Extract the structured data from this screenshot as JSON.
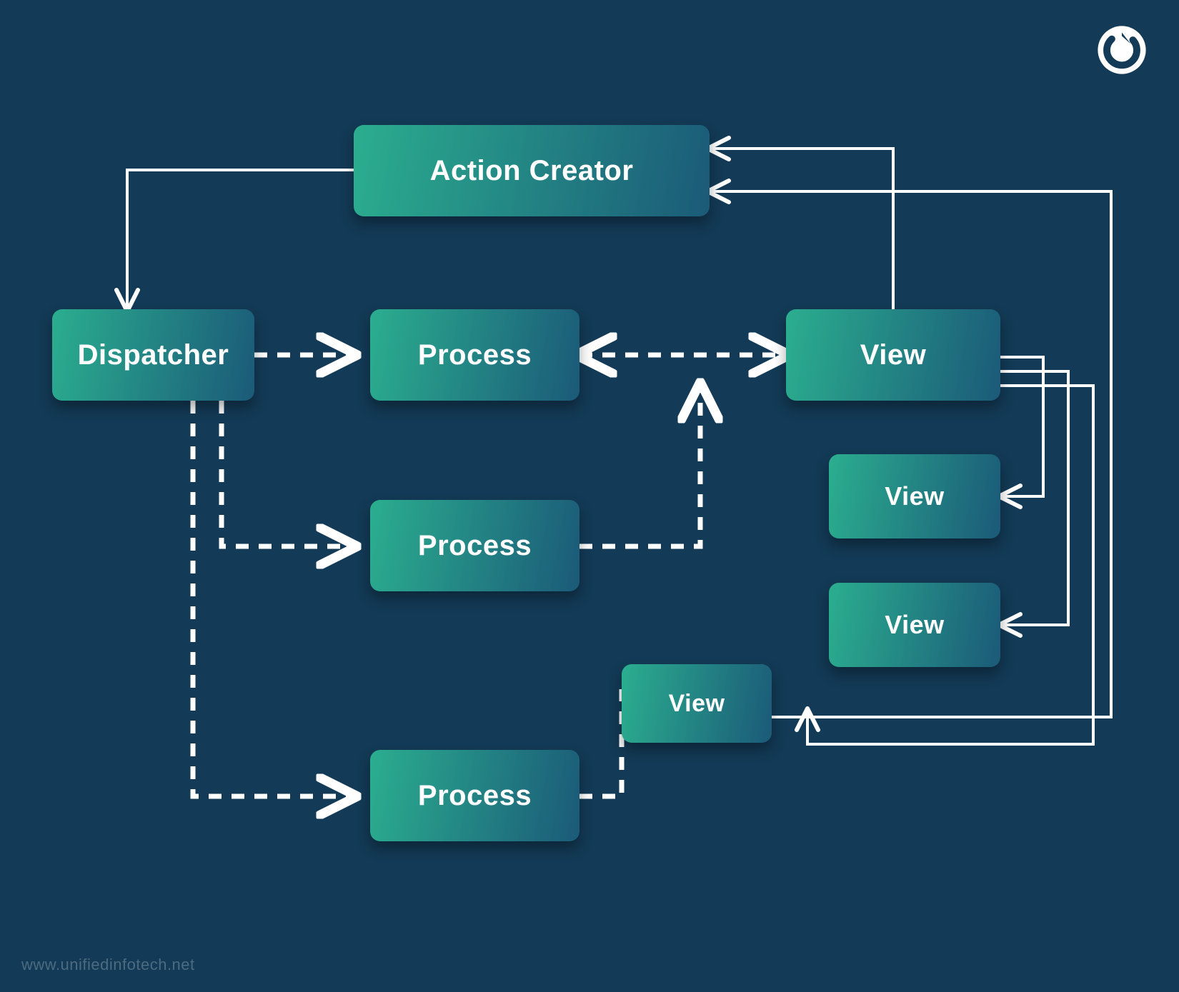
{
  "nodes": {
    "actionCreator": "Action Creator",
    "dispatcher": "Dispatcher",
    "process1": "Process",
    "process2": "Process",
    "process3": "Process",
    "viewTop": "View",
    "viewMid1": "View",
    "viewMid2": "View",
    "viewMid3": "View"
  },
  "footer": "www.unifiedinfotech.net",
  "colors": {
    "background": "#133A56",
    "nodeGradientStart": "#2BAE8F",
    "nodeGradientEnd": "#1B5A78",
    "connector": "#FFFFFF"
  },
  "diagram": {
    "description": "Flux-style unidirectional data flow diagram",
    "flows_solid": [
      "Action Creator -> Dispatcher",
      "View (top) -> Action Creator",
      "View (mid3) -> Action Creator",
      "View (top) -> View (mid1)",
      "View (top) -> View (mid2)",
      "View (top) -> View (mid3)"
    ],
    "flows_dashed": [
      "Dispatcher -> Process (1)",
      "Dispatcher -> Process (2)",
      "Dispatcher -> Process (3)",
      "Process (1) <-> View (top)",
      "Process (2) -> View (top) path",
      "Process (3) -> View (mid3)"
    ]
  }
}
